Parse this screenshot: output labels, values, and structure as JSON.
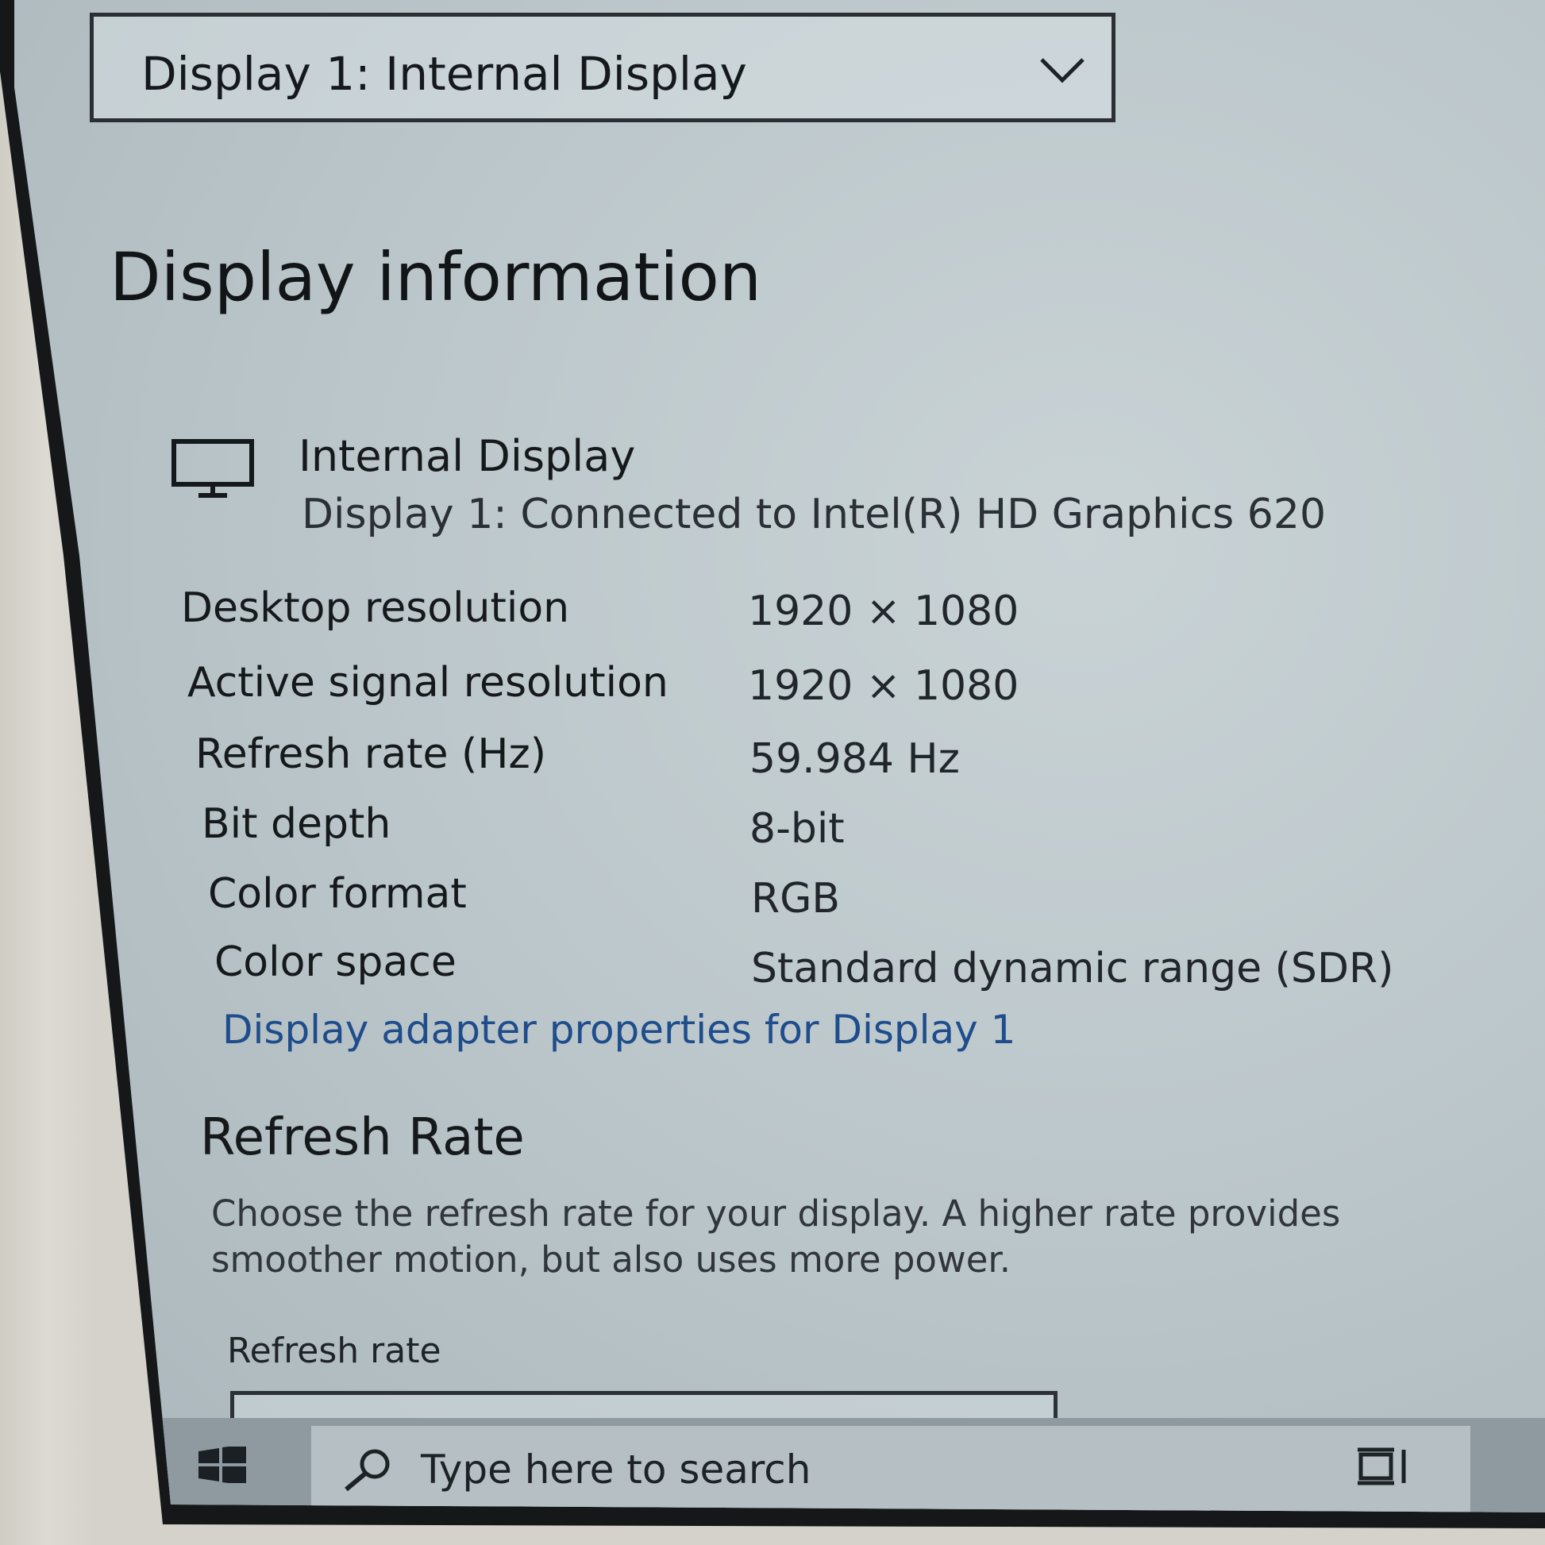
{
  "display_selector": {
    "value": "Display 1: Internal Display"
  },
  "display_information": {
    "title": "Display information",
    "display_name": "Internal Display",
    "connection": "Display 1: Connected to Intel(R) HD Graphics 620",
    "rows": [
      {
        "label": "Desktop resolution",
        "value": "1920 × 1080"
      },
      {
        "label": "Active signal resolution",
        "value": "1920 × 1080"
      },
      {
        "label": "Refresh rate (Hz)",
        "value": "59.984 Hz"
      },
      {
        "label": "Bit depth",
        "value": "8-bit"
      },
      {
        "label": "Color format",
        "value": "RGB"
      },
      {
        "label": "Color space",
        "value": "Standard dynamic range (SDR)"
      }
    ],
    "adapter_link": "Display adapter properties for Display 1"
  },
  "refresh_rate": {
    "heading": "Refresh Rate",
    "description": "Choose the refresh rate for your display. A higher rate provides smoother motion, but also uses more power.",
    "label": "Refresh rate"
  },
  "taskbar": {
    "search_placeholder": "Type here to search"
  },
  "icons": {
    "dropdown": "chevron-down-icon",
    "display": "monitor-icon",
    "start": "windows-logo-icon",
    "search": "search-icon",
    "task_view": "task-view-icon"
  }
}
